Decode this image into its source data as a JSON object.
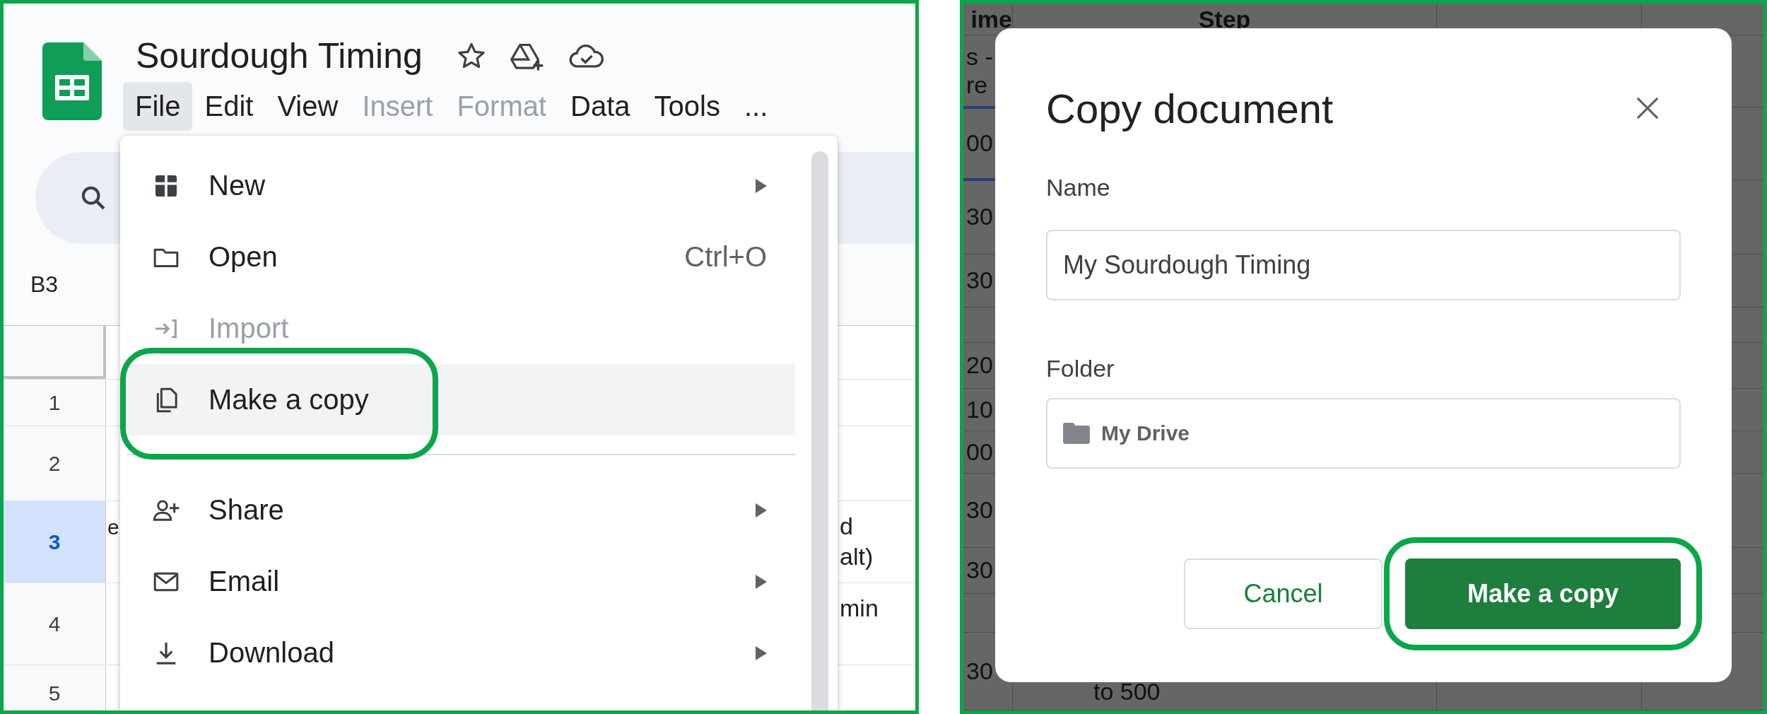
{
  "left_panel": {
    "document_title": "Sourdough Timing",
    "menu_bar": [
      {
        "label": "File",
        "selected": true,
        "disabled": false
      },
      {
        "label": "Edit",
        "selected": false,
        "disabled": false
      },
      {
        "label": "View",
        "selected": false,
        "disabled": false
      },
      {
        "label": "Insert",
        "selected": false,
        "disabled": true
      },
      {
        "label": "Format",
        "selected": false,
        "disabled": true
      },
      {
        "label": "Data",
        "selected": false,
        "disabled": false
      },
      {
        "label": "Tools",
        "selected": false,
        "disabled": false
      },
      {
        "label": "...",
        "selected": false,
        "disabled": false
      }
    ],
    "name_box": "B3",
    "grid_rows": [
      {
        "number": "1",
        "selected": false
      },
      {
        "number": "2",
        "selected": false
      },
      {
        "number": "3",
        "selected": true,
        "column_1": "e",
        "column_2": "d\nalt)"
      },
      {
        "number": "4",
        "selected": false,
        "column_2": "min"
      },
      {
        "number": "5",
        "selected": false
      }
    ],
    "file_menu": {
      "items": [
        {
          "kind": "item",
          "label": "New",
          "submenu": true,
          "disabled": false,
          "selected": false,
          "annotated": false
        },
        {
          "kind": "item",
          "label": "Open",
          "shortcut": "Ctrl+O",
          "submenu": false,
          "disabled": false,
          "selected": false,
          "annotated": false
        },
        {
          "kind": "item",
          "label": "Import",
          "submenu": false,
          "disabled": true,
          "selected": false,
          "annotated": false
        },
        {
          "kind": "item",
          "label": "Make a copy",
          "submenu": false,
          "disabled": false,
          "selected": true,
          "annotated": true
        },
        {
          "kind": "divider"
        },
        {
          "kind": "item",
          "label": "Share",
          "submenu": true,
          "disabled": false,
          "selected": false,
          "annotated": false
        },
        {
          "kind": "item",
          "label": "Email",
          "submenu": true,
          "disabled": false,
          "selected": false,
          "annotated": false
        },
        {
          "kind": "item",
          "label": "Download",
          "submenu": true,
          "disabled": false,
          "selected": false,
          "annotated": false
        }
      ]
    }
  },
  "right_panel": {
    "background_sheet": {
      "headers": [
        "ime",
        "Step"
      ],
      "rows": [
        {
          "time": "s -\nre",
          "selected": false
        },
        {
          "time": "00",
          "selected": true
        },
        {
          "time": "30",
          "selected": false
        },
        {
          "time": "30",
          "selected": false
        },
        {
          "selected": false
        },
        {
          "time": "20",
          "selected": false
        },
        {
          "time": "10",
          "selected": false
        },
        {
          "time": "00",
          "selected": false
        },
        {
          "time": "30",
          "selected": false
        },
        {
          "time": "30",
          "selected": false
        },
        {
          "selected": false
        },
        {
          "time": "30",
          "step": "to 500",
          "selected": false
        }
      ]
    },
    "dialog": {
      "title": "Copy document",
      "name_label": "Name",
      "name_value": "My Sourdough Timing",
      "folder_label": "Folder",
      "folder_value": "My Drive",
      "buttons": [
        {
          "label": "Cancel",
          "kind": "secondary",
          "annotated": false
        },
        {
          "label": "Make a copy",
          "kind": "primary",
          "annotated": true
        }
      ]
    }
  }
}
